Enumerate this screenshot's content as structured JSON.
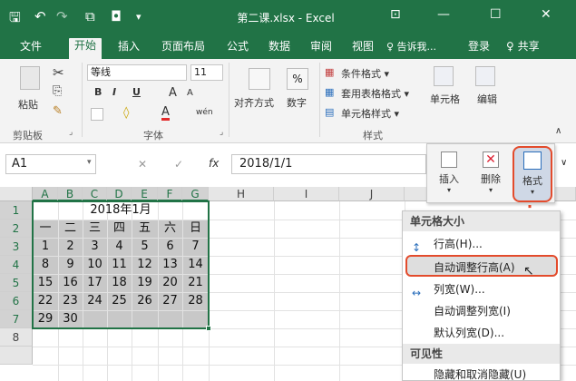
{
  "window": {
    "title": "第二课.xlsx - Excel",
    "controls": {
      "minimize": "—",
      "maximize": "☐",
      "close": "✕",
      "ribbon_display": "⊡"
    }
  },
  "quick_access": {
    "save": "🖫",
    "undo": "↶",
    "redo": "↷",
    "preview": "⧉",
    "camera": "◘",
    "more": "▾"
  },
  "tabs": [
    {
      "label": "文件"
    },
    {
      "label": "开始",
      "active": true
    },
    {
      "label": "插入"
    },
    {
      "label": "页面布局"
    },
    {
      "label": "公式"
    },
    {
      "label": "数据"
    },
    {
      "label": "审阅"
    },
    {
      "label": "视图"
    }
  ],
  "tell_me": "♀ 告诉我...",
  "login": "登录",
  "share": "♀ 共享",
  "ribbon": {
    "clipboard": {
      "paste": "粘贴",
      "group": "剪贴板"
    },
    "font": {
      "name": "等线",
      "size": "11",
      "bold": "B",
      "italic": "I",
      "underline": "U",
      "grow": "A",
      "shrink": "A",
      "wen": "wén",
      "group": "字体"
    },
    "alignment": {
      "label": "对齐方式"
    },
    "number": {
      "label": "数字",
      "symbol": "%"
    },
    "styles": {
      "conditional": "条件格式 ▾",
      "table": "套用表格格式 ▾",
      "cell": "单元格样式 ▾",
      "group": "样式"
    },
    "cells": {
      "label": "单元格"
    },
    "editing": {
      "label": "编辑"
    }
  },
  "formula_bar": {
    "name_box": "A1",
    "fx": "fx",
    "cancel": "✕",
    "enter": "✓",
    "value": "2018/1/1"
  },
  "cells_panel": {
    "insert": "插入",
    "delete": "删除",
    "format": "格式"
  },
  "grid": {
    "columns": [
      "A",
      "B",
      "C",
      "D",
      "E",
      "F",
      "G",
      "H",
      "I",
      "J"
    ],
    "rows": [
      "1",
      "2",
      "3",
      "4",
      "5",
      "6",
      "7",
      "8"
    ],
    "title": "2018年1月",
    "weekdays": [
      "一",
      "二",
      "三",
      "四",
      "五",
      "六",
      "日"
    ],
    "weeks": [
      [
        "1",
        "2",
        "3",
        "4",
        "5",
        "6",
        "7"
      ],
      [
        "8",
        "9",
        "10",
        "11",
        "12",
        "13",
        "14"
      ],
      [
        "15",
        "16",
        "17",
        "18",
        "19",
        "20",
        "21"
      ],
      [
        "22",
        "23",
        "24",
        "25",
        "26",
        "27",
        "28"
      ],
      [
        "29",
        "30",
        "",
        "",
        "",
        "",
        ""
      ]
    ]
  },
  "menu": {
    "section_size": "单元格大小",
    "row_height": "行高(H)...",
    "autofit_row": "自动调整行高(A)",
    "col_width": "列宽(W)...",
    "autofit_col": "自动调整列宽(I)",
    "default_width": "默认列宽(D)...",
    "section_visibility": "可见性",
    "hide_unhide": "隐藏和取消隐藏(U)"
  },
  "colors": {
    "excel_green": "#217346",
    "highlight": "#e34b2c",
    "selection": "#c8c8c8"
  }
}
